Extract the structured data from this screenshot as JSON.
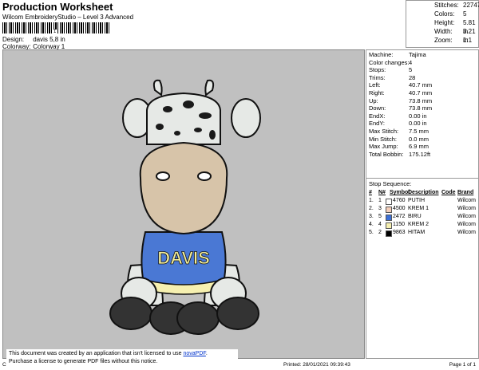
{
  "header": {
    "title": "Production Worksheet",
    "subtitle": "Wilcom EmbroideryStudio – Level 3 Advanced",
    "barcode_number": "1",
    "design_label": "Design:",
    "design_value": "davis 5,8 in",
    "colorway_label": "Colorway:",
    "colorway_value": "Colorway 1"
  },
  "summary": [
    {
      "k": "Stitches:",
      "v": "22747"
    },
    {
      "k": "Colors:",
      "v": "5"
    },
    {
      "k": "Height:",
      "v": "5.81 in"
    },
    {
      "k": "Width:",
      "v": "3.21 in"
    },
    {
      "k": "Zoom:",
      "v": "1:1"
    }
  ],
  "machine": [
    {
      "k": "Machine:",
      "v": "Tajima"
    },
    {
      "k": "Color changes:",
      "v": "4"
    },
    {
      "k": "Stops:",
      "v": "5"
    },
    {
      "k": "Trims:",
      "v": "28"
    },
    {
      "k": "Left:",
      "v": "40.7 mm"
    },
    {
      "k": "Right:",
      "v": "40.7 mm"
    },
    {
      "k": "Up:",
      "v": "73.8 mm"
    },
    {
      "k": "Down:",
      "v": "73.8 mm"
    },
    {
      "k": "EndX:",
      "v": "0.00 in"
    },
    {
      "k": "EndY:",
      "v": "0.00 in"
    },
    {
      "k": "Max Stitch:",
      "v": "7.5 mm"
    },
    {
      "k": "Min Stitch:",
      "v": "0.0 mm"
    },
    {
      "k": "Max Jump:",
      "v": "6.9 mm"
    },
    {
      "k": "Total Bobbin:",
      "v": "175.12ft"
    }
  ],
  "stop_sequence": {
    "title": "Stop Sequence:",
    "headers": [
      "#",
      "N#",
      "Symbol",
      "Description",
      "Code",
      "Brand"
    ],
    "rows": [
      {
        "num": "1.",
        "n": "1",
        "color": "#ffffff",
        "symbol": "4760",
        "desc": "PUTIH",
        "brand": "Wilcom"
      },
      {
        "num": "2.",
        "n": "3",
        "color": "#f3cdb8",
        "symbol": "4500",
        "desc": "KREM 1",
        "brand": "Wilcom"
      },
      {
        "num": "3.",
        "n": "5",
        "color": "#3b6fd6",
        "symbol": "2472",
        "desc": "BIRU",
        "brand": "Wilcom"
      },
      {
        "num": "4.",
        "n": "4",
        "color": "#f6f0b0",
        "symbol": "1150",
        "desc": "KREM 2",
        "brand": "Wilcom"
      },
      {
        "num": "5.",
        "n": "2",
        "color": "#000000",
        "symbol": "9863",
        "desc": "HITAM",
        "brand": "Wilcom"
      }
    ]
  },
  "design": {
    "shirt_text": "DAVIS",
    "colors": {
      "canvas": "#c0c0c0",
      "body": "#e6e9e6",
      "spots": "#1a1a1a",
      "muzzle": "#d7c4a9",
      "shirt": "#4a78d4",
      "shirt_text": "#f3ee9a",
      "feet": "#3a3a3a",
      "outline": "#111111"
    }
  },
  "footer": {
    "cr": "Cr",
    "printed": "Printed: 28/01/2021 09:39:43",
    "page": "Page 1 of 1",
    "notice_line1": "This document was created by an application that isn't licensed to use ",
    "notice_link": "novaPDF",
    "notice_line1_end": ".",
    "notice_line2": "Purchase a license to generate PDF files without this notice."
  }
}
